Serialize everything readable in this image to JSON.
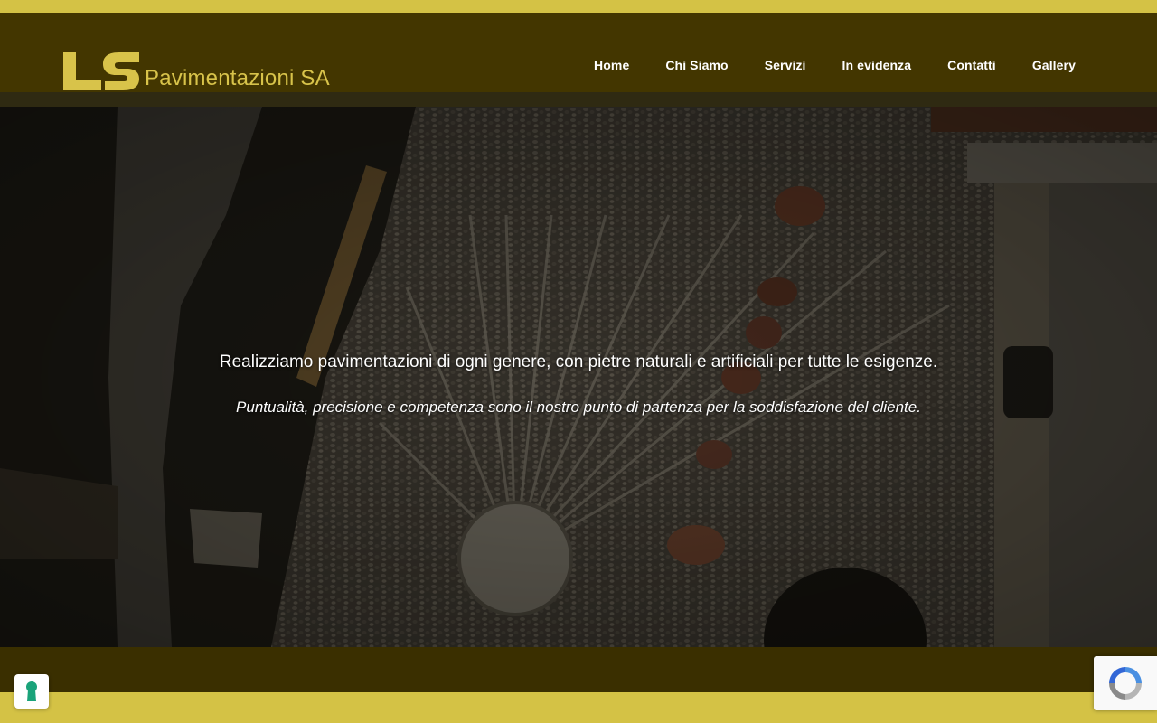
{
  "brand": {
    "logo_mark": "LS",
    "name": "Pavimentazioni SA",
    "color": "#d8c34a"
  },
  "nav": {
    "items": [
      {
        "label": "Home"
      },
      {
        "label": "Chi Siamo"
      },
      {
        "label": "Servizi"
      },
      {
        "label": "In evidenza"
      },
      {
        "label": "Contatti"
      },
      {
        "label": "Gallery"
      }
    ]
  },
  "hero": {
    "headline": "Realizziamo pavimentazioni di ogni genere, con pietre naturali e artificiali per tutte le esigenze.",
    "subline": "Puntualità, precisione e competenza sono il nostro punto di partenza per la soddisfazione del cliente.",
    "image": "aerial-cobblestone-courtyard"
  },
  "widgets": {
    "privacy_icon": "keyhole-icon",
    "recaptcha_icon": "recaptcha-icon"
  },
  "colors": {
    "accent_strip": "#d4c245",
    "header_bg": "#433600",
    "footer_bg": "#3a2f00"
  }
}
